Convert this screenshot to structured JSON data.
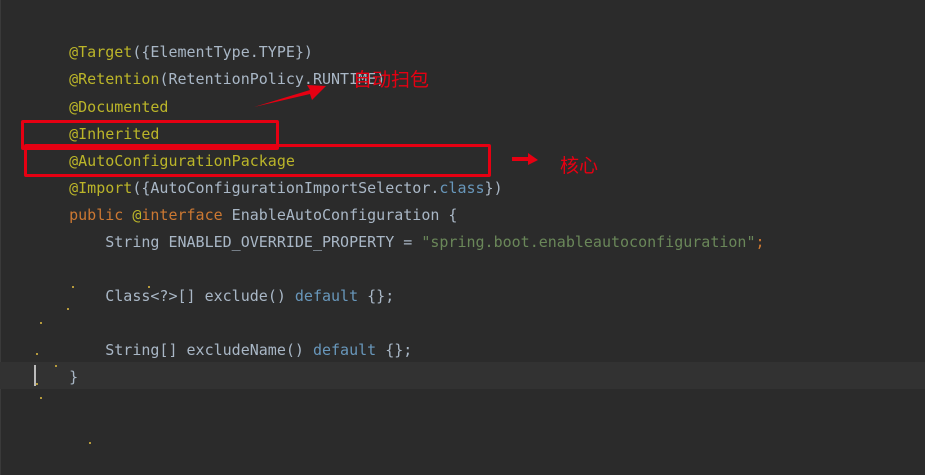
{
  "code": {
    "line1": {
      "at": "@",
      "name": "Target",
      "open": "({",
      "arg": "ElementType.TYPE",
      "close": "})"
    },
    "line2": {
      "at": "@",
      "name": "Retention",
      "open": "(",
      "arg": "RetentionPolicy.RUNTIME",
      "close": ")"
    },
    "line3": {
      "at": "@",
      "name": "Documented"
    },
    "line4": {
      "at": "@",
      "name": "Inherited"
    },
    "line5": {
      "at": "@",
      "name": "AutoConfigurationPackage"
    },
    "line6": {
      "at": "@",
      "name": "Import",
      "open": "({",
      "arg": "AutoConfigurationImportSelector.",
      "kw": "class",
      "close": "})"
    },
    "line7": {
      "kw1": "public",
      "at": " @",
      "kw2": "interface",
      "rest": " EnableAutoConfiguration {"
    },
    "line8": {
      "indent": "    ",
      "type": "String ",
      "name": "ENABLED_OVERRIDE_PROPERTY",
      "eq": " = ",
      "str": "\"spring.boot.enableautoconfiguration\"",
      "end": ";"
    },
    "line10": {
      "indent": "    ",
      "type": "Class<?>[] ",
      "method": "exclude",
      "parens": "() ",
      "kw": "default",
      "rest": " {};"
    },
    "line12": {
      "indent": "    ",
      "type": "String[] ",
      "method": "excludeName",
      "parens": "() ",
      "kw": "default",
      "rest": " {};"
    },
    "line13": {
      "brace": "}"
    }
  },
  "annotations": {
    "auto_scan_note": "自动扫包",
    "core_note": "核心"
  },
  "colors": {
    "background": "#2b2b2b",
    "annotation": "#bbb529",
    "keyword": "#cc7832",
    "string": "#6a8759",
    "text": "#a9b7c6",
    "highlight_red": "#e60012"
  }
}
